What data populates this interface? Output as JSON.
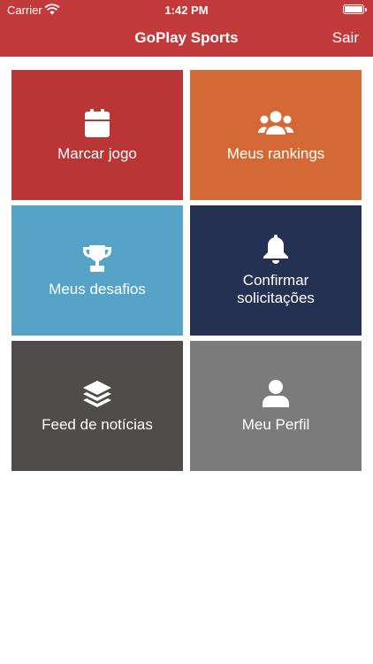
{
  "status_bar": {
    "carrier": "Carrier",
    "time": "1:42 PM"
  },
  "navbar": {
    "title": "GoPlay Sports",
    "logout_label": "Sair"
  },
  "tiles": [
    {
      "label": "Marcar jogo",
      "icon": "calendar-icon",
      "color": "#b93536"
    },
    {
      "label": "Meus rankings",
      "icon": "users-group-icon",
      "color": "#d56935"
    },
    {
      "label": "Meus desafios",
      "icon": "trophy-icon",
      "color": "#55a3c6"
    },
    {
      "label_line1": "Confirmar",
      "label_line2": "solicitações",
      "icon": "bell-icon",
      "color": "#243152"
    },
    {
      "label": "Feed de notícias",
      "icon": "layers-icon",
      "color": "#4f4c4b"
    },
    {
      "label": "Meu Perfil",
      "icon": "user-icon",
      "color": "#7c7b7b"
    }
  ],
  "colors": {
    "header_background": "#c23a3a"
  }
}
